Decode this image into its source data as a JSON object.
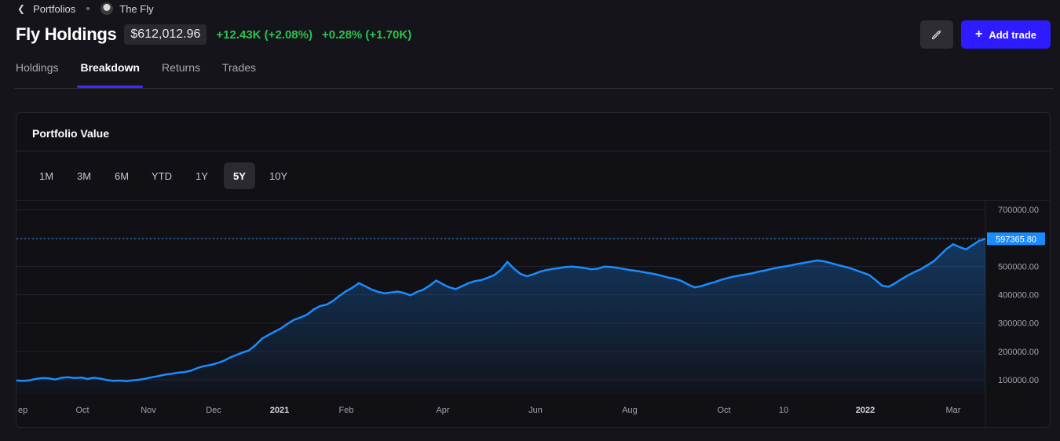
{
  "breadcrumb": {
    "back_label": "Portfolios",
    "current": "The Fly"
  },
  "header": {
    "title": "Fly Holdings",
    "value": "$612,012.96",
    "day_change": "+12.43K (+2.08%)",
    "change2": "+0.28% (+1.70K)",
    "add_trade_label": "Add trade"
  },
  "tabs": [
    "Holdings",
    "Breakdown",
    "Returns",
    "Trades"
  ],
  "active_tab": "Breakdown",
  "card": {
    "title": "Portfolio Value"
  },
  "ranges": [
    "1M",
    "3M",
    "6M",
    "YTD",
    "1Y",
    "5Y",
    "10Y"
  ],
  "active_range": "5Y",
  "colors": {
    "accent": "#2f1bff",
    "gain": "#27c44d",
    "line": "#1a8cff",
    "current_tag": "#1a8cff"
  },
  "chart_data": {
    "type": "area",
    "current_value_label": "597365.80",
    "current_value": 597365.8,
    "ylim": [
      50000,
      720000
    ],
    "y_ticks": [
      {
        "value": 100000,
        "label": "100000.00"
      },
      {
        "value": 200000,
        "label": "200000.00"
      },
      {
        "value": 300000,
        "label": "300000.00"
      },
      {
        "value": 400000,
        "label": "400000.00"
      },
      {
        "value": 500000,
        "label": "500000.00"
      },
      {
        "value": 600000,
        "label": "600000.00"
      },
      {
        "value": 700000,
        "label": "700000.00"
      }
    ],
    "x_ticks": [
      {
        "label": "ep",
        "bold": false
      },
      {
        "label": "Oct",
        "bold": false
      },
      {
        "label": "Nov",
        "bold": false
      },
      {
        "label": "Dec",
        "bold": false
      },
      {
        "label": "2021",
        "bold": true
      },
      {
        "label": "Feb",
        "bold": false
      },
      {
        "label": "Apr",
        "bold": false
      },
      {
        "label": "Jun",
        "bold": false
      },
      {
        "label": "Aug",
        "bold": false
      },
      {
        "label": "Oct",
        "bold": false
      },
      {
        "label": "10",
        "bold": false
      },
      {
        "label": "2022",
        "bold": true
      },
      {
        "label": "Mar",
        "bold": false
      }
    ],
    "series": [
      {
        "values": [
          97000,
          96000,
          98000,
          103000,
          106000,
          105000,
          101000,
          107000,
          109000,
          106000,
          108000,
          103000,
          107000,
          104000,
          99000,
          96000,
          97000,
          95000,
          98000,
          100000,
          104000,
          109000,
          113000,
          118000,
          121000,
          125000,
          127000,
          132000,
          141000,
          148000,
          152000,
          158000,
          166000,
          178000,
          187000,
          196000,
          204000,
          222000,
          245000,
          258000,
          270000,
          282000,
          298000,
          312000,
          320000,
          330000,
          348000,
          360000,
          365000,
          378000,
          396000,
          412000,
          425000,
          441000,
          430000,
          418000,
          410000,
          405000,
          408000,
          411000,
          406000,
          398000,
          410000,
          418000,
          433000,
          450000,
          437000,
          426000,
          420000,
          430000,
          441000,
          448000,
          452000,
          460000,
          470000,
          488000,
          516000,
          492000,
          474000,
          465000,
          472000,
          481000,
          487000,
          491000,
          494000,
          498000,
          499000,
          497000,
          494000,
          490000,
          492000,
          499000,
          498000,
          495000,
          491000,
          487000,
          484000,
          480000,
          476000,
          472000,
          466000,
          460000,
          456000,
          448000,
          436000,
          426000,
          430000,
          438000,
          444000,
          452000,
          458000,
          464000,
          468000,
          472000,
          476000,
          482000,
          486000,
          492000,
          496000,
          500000,
          504000,
          509000,
          513000,
          517000,
          521000,
          518000,
          512000,
          506000,
          500000,
          494000,
          486000,
          478000,
          470000,
          452000,
          432000,
          428000,
          440000,
          455000,
          468000,
          480000,
          490000,
          504000,
          518000,
          540000,
          562000,
          578000,
          568000,
          560000,
          575000,
          590000,
          597365
        ]
      }
    ]
  }
}
